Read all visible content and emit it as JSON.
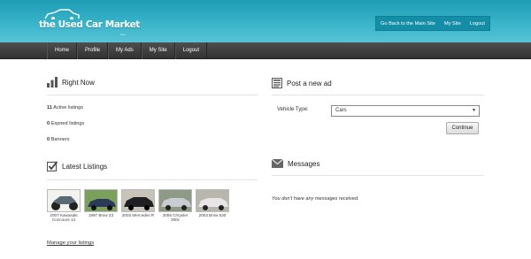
{
  "brand": {
    "logo_text": "the Used Car Market",
    "logo_sub": "com"
  },
  "toplinks": [
    "Go Back to the Main Site",
    "My Site",
    "Logout"
  ],
  "nav": [
    "Home",
    "Profile",
    "My Ads",
    "My Site",
    "Logout"
  ],
  "right_now": {
    "title": "Right Now",
    "stats": [
      {
        "count": "11",
        "label": "Active listings"
      },
      {
        "count": "0",
        "label": "Expired listings"
      },
      {
        "count": "0",
        "label": "Banners"
      }
    ]
  },
  "latest": {
    "title": "Latest Listings",
    "items": [
      {
        "caption": "2007 Kawasaki Concours 14",
        "color": "#5a6a72"
      },
      {
        "caption": "1997 Bmw Z3",
        "color": "#2c3a5a"
      },
      {
        "caption": "2003 Mercedes R",
        "color": "#1f1f24"
      },
      {
        "caption": "2006 Chrysler 300c",
        "color": "#c9ccd0"
      },
      {
        "caption": "2003 Bmw 530",
        "color": "#e6e6e6"
      }
    ],
    "manage_label": "Manage your listings"
  },
  "post_ad": {
    "title": "Post a new ad",
    "vehicle_label": "Vehicle Type:",
    "vehicle_value": "Cars",
    "continue_label": "Continue"
  },
  "messages": {
    "title": "Messages",
    "empty_text": "You don't have any messages received."
  }
}
